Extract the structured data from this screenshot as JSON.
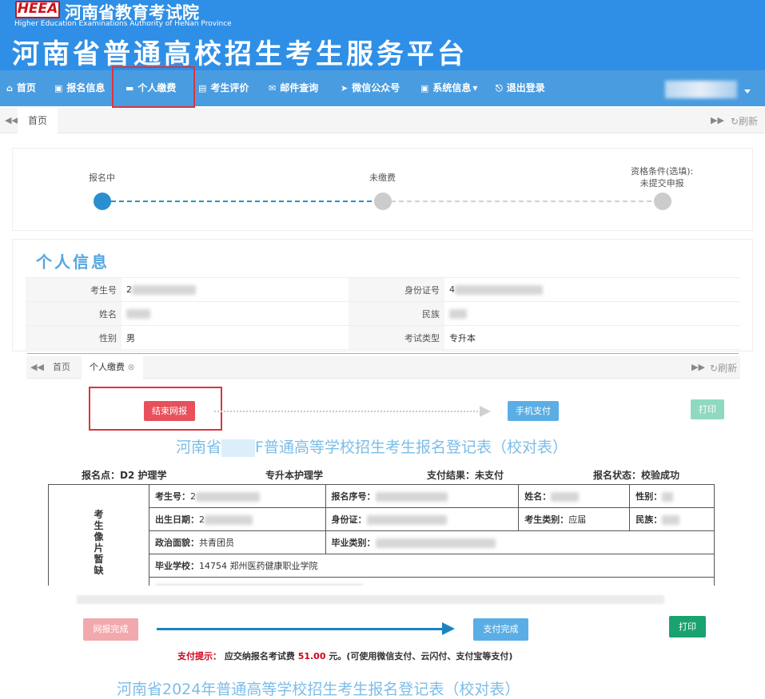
{
  "header": {
    "logo_text": "HEEA",
    "org_name": "河南省教育考试院",
    "org_name_en": "Higher Education Examinations Authority of HeNan Province",
    "platform_title": "河南省普通高校招生考生服务平台"
  },
  "nav": {
    "items": [
      {
        "icon": "home-icon",
        "glyph": "⌂",
        "label": "首页"
      },
      {
        "icon": "id-card-icon",
        "glyph": "▣",
        "label": "报名信息"
      },
      {
        "icon": "credit-card-icon",
        "glyph": "▬",
        "label": "个人缴费"
      },
      {
        "icon": "clipboard-icon",
        "glyph": "▤",
        "label": "考生评价"
      },
      {
        "icon": "envelope-icon",
        "glyph": "✉",
        "label": "邮件查询"
      },
      {
        "icon": "paper-plane-icon",
        "glyph": "➤",
        "label": "微信公众号"
      },
      {
        "icon": "info-card-icon",
        "glyph": "▣",
        "label": "系统信息"
      },
      {
        "icon": "logout-icon",
        "glyph": "⎋",
        "label": "退出登录"
      }
    ],
    "dropdown_caret": "▾"
  },
  "tabs1": {
    "home_label": "首页",
    "refresh_label": "刷新"
  },
  "steps": [
    {
      "label": "报名中",
      "status": "active",
      "color": "#2a8fcf"
    },
    {
      "label": "未缴费",
      "status": "pending",
      "color": "#cccccc"
    },
    {
      "label": "资格条件(选填):\n未提交申报",
      "status": "pending",
      "color": "#cccccc"
    }
  ],
  "personal_info": {
    "title": "个人信息",
    "rows": [
      {
        "left_label": "考生号",
        "left_value": "2",
        "right_label": "身份证号",
        "right_value": "4"
      },
      {
        "left_label": "姓名",
        "left_value": "",
        "right_label": "民族",
        "right_value": ""
      },
      {
        "left_label": "性别",
        "left_value": "男",
        "right_label": "考试类型",
        "right_value": "专升本"
      }
    ]
  },
  "tabs2": {
    "home_label": "首页",
    "active_tab": "个人缴费",
    "refresh_label": "刷新"
  },
  "payment_flow": {
    "end_button": "结束网报",
    "mobile_pay_button": "手机支付",
    "print_button": "打印",
    "colors": {
      "end": "#e8505b",
      "mobile": "#5aaee5",
      "print_faded": "#8fd9c0"
    }
  },
  "form": {
    "title_prefix": "河南省",
    "title_suffix": "F普通高等学校招生考生报名登记表（校对表）",
    "summary": {
      "site": "报名点：D2 护理学",
      "major": "专升本护理学",
      "pay_result": "支付结果：未支付",
      "reg_status": "报名状态：校验成功"
    },
    "photo_text": "考\n生\n像\n片\n暂\n缺",
    "rows": [
      [
        {
          "k": "考生号：",
          "v": "2"
        },
        {
          "k": "报名序号：",
          "v": ""
        },
        {
          "k": "姓名：",
          "v": ""
        },
        {
          "k": "性别：",
          "v": ""
        }
      ],
      [
        {
          "k": "出生日期：",
          "v": "2"
        },
        {
          "k": "身份证：",
          "v": ""
        },
        {
          "k": "考生类别：",
          "v": "应届"
        },
        {
          "k": "民族：",
          "v": ""
        }
      ],
      [
        {
          "k": "政治面貌：",
          "v": "共青团员"
        },
        {
          "k": "毕业类别：",
          "v": ""
        }
      ],
      [
        {
          "k": "毕业学校：",
          "v": "14754 郑州医药健康职业学院"
        }
      ]
    ]
  },
  "bottom_flow": {
    "done_button": "网报完成",
    "paid_button": "支付完成",
    "print_button": "打印",
    "colors": {
      "done_faded": "#f2a9ad",
      "paid": "#5aaee5",
      "print": "#1aa36e",
      "arrow": "#1b84bf"
    }
  },
  "tip": {
    "label": "支付提示：",
    "text_before": "应交纳报名考试费",
    "amount": "51.00",
    "text_after": "元。(可使用微信支付、云闪付、支付宝等支付)"
  },
  "bottom_title": "河南省2024年普通高等学校招生考生报名登记表（校对表）"
}
